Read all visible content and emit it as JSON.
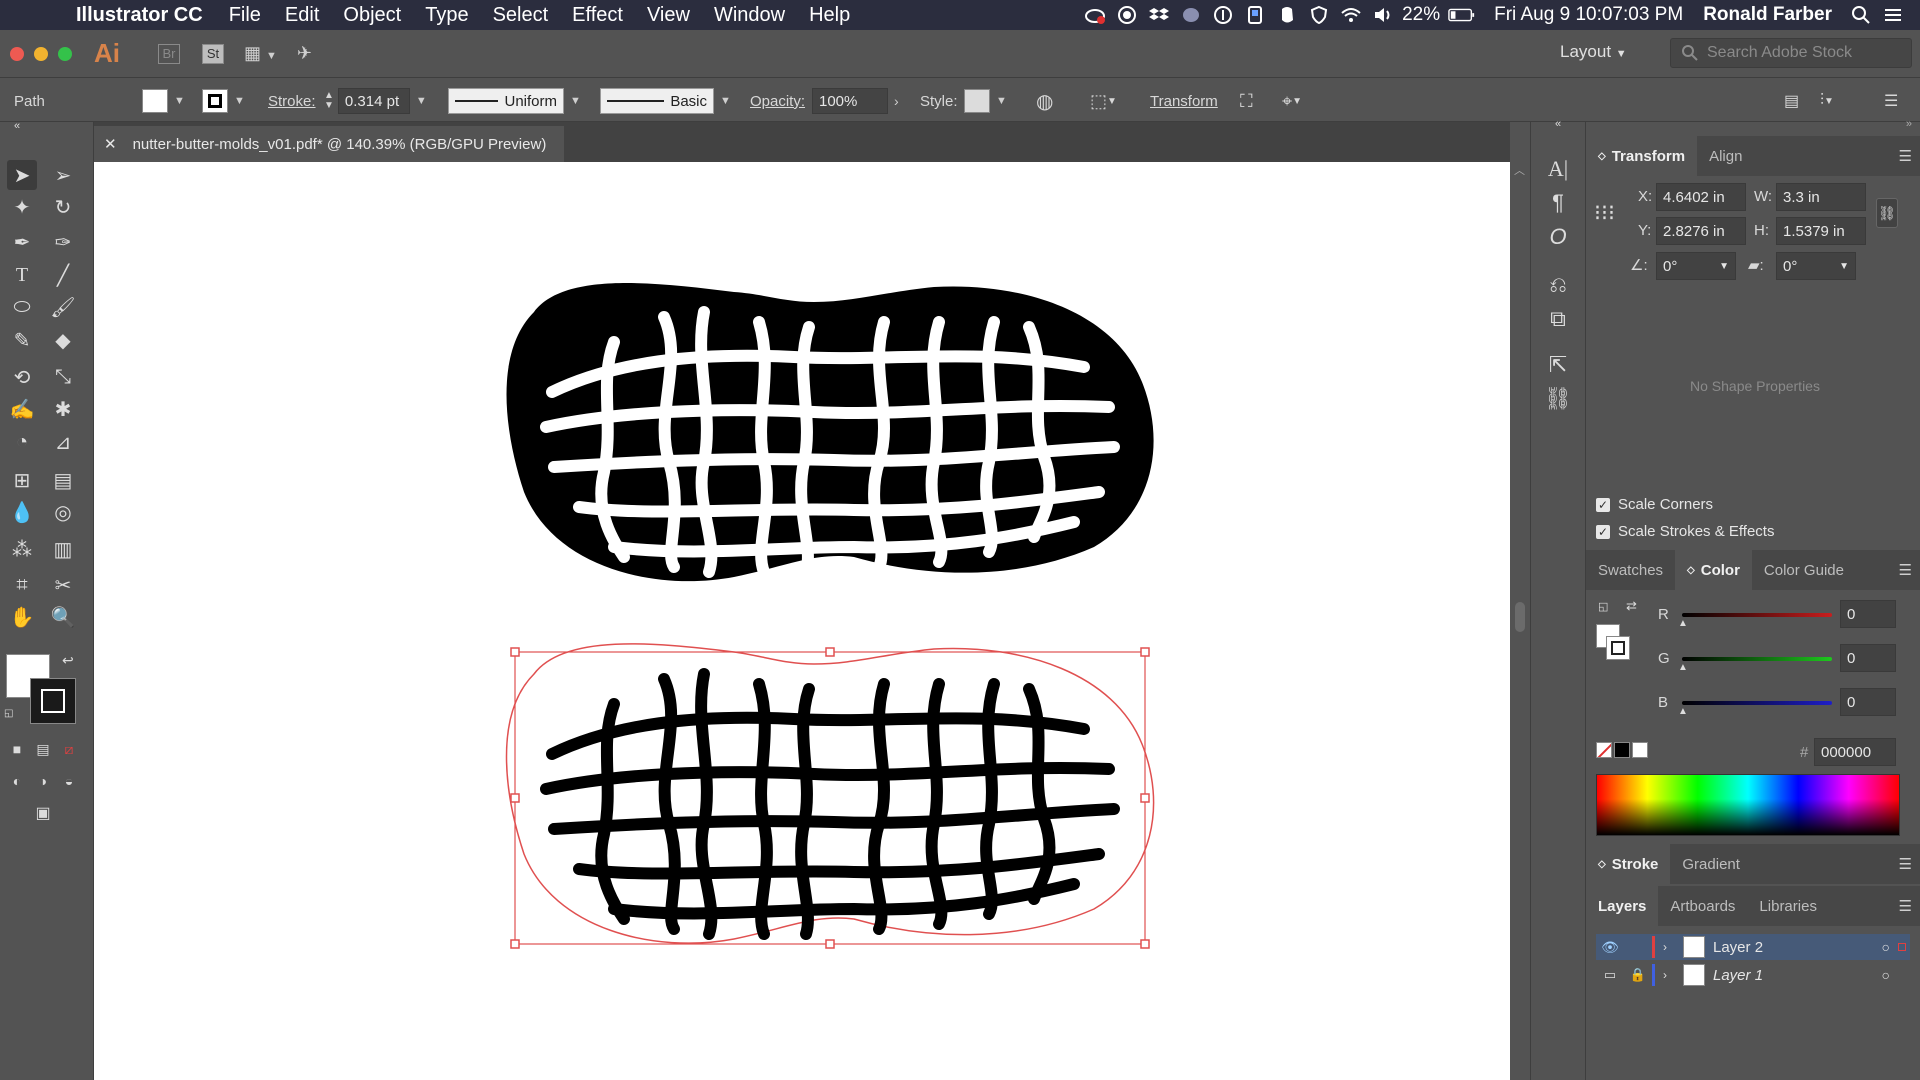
{
  "menubar": {
    "app": "Illustrator CC",
    "items": [
      "File",
      "Edit",
      "Object",
      "Type",
      "Select",
      "Effect",
      "View",
      "Window",
      "Help"
    ],
    "battery": "22%",
    "datetime": "Fri Aug 9  10:07:03 PM",
    "user": "Ronald Farber"
  },
  "appbar": {
    "logo": "Ai",
    "bridge": "Br",
    "stock_btn": "St",
    "workspace": "Layout",
    "search_placeholder": "Search Adobe Stock"
  },
  "control": {
    "selection": "Path",
    "stroke_label": "Stroke:",
    "stroke_weight": "0.314 pt",
    "profile": "Uniform",
    "brush": "Basic",
    "opacity_label": "Opacity:",
    "opacity": "100%",
    "style_label": "Style:",
    "transform_btn": "Transform"
  },
  "document": {
    "tab_title": "nutter-butter-molds_v01.pdf* @ 140.39% (RGB/GPU Preview)"
  },
  "transform_panel": {
    "tabs": [
      "Transform",
      "Align"
    ],
    "x_label": "X:",
    "x": "4.6402 in",
    "y_label": "Y:",
    "y": "2.8276 in",
    "w_label": "W:",
    "w": "3.3 in",
    "h_label": "H:",
    "h": "1.5379 in",
    "rotate": "0°",
    "shear": "0°",
    "no_shape": "No Shape Properties",
    "scale_corners": "Scale Corners",
    "scale_strokes": "Scale Strokes & Effects"
  },
  "color_panel": {
    "tabs": [
      "Swatches",
      "Color",
      "Color Guide"
    ],
    "r_label": "R",
    "r": "0",
    "g_label": "G",
    "g": "0",
    "b_label": "B",
    "b": "0",
    "hash": "#",
    "hex": "000000",
    "colors": {
      "r_track": "#c81e1e",
      "g_track": "#1ec81e",
      "b_track": "#1e1ec8",
      "selection": "#e05050"
    }
  },
  "stroke_panel": {
    "tabs": [
      "Stroke",
      "Gradient"
    ]
  },
  "layers_panel": {
    "tabs": [
      "Layers",
      "Artboards",
      "Libraries"
    ],
    "layers": [
      {
        "name": "Layer 2",
        "color": "#e04040"
      },
      {
        "name": "Layer 1",
        "color": "#4060e0"
      }
    ]
  }
}
